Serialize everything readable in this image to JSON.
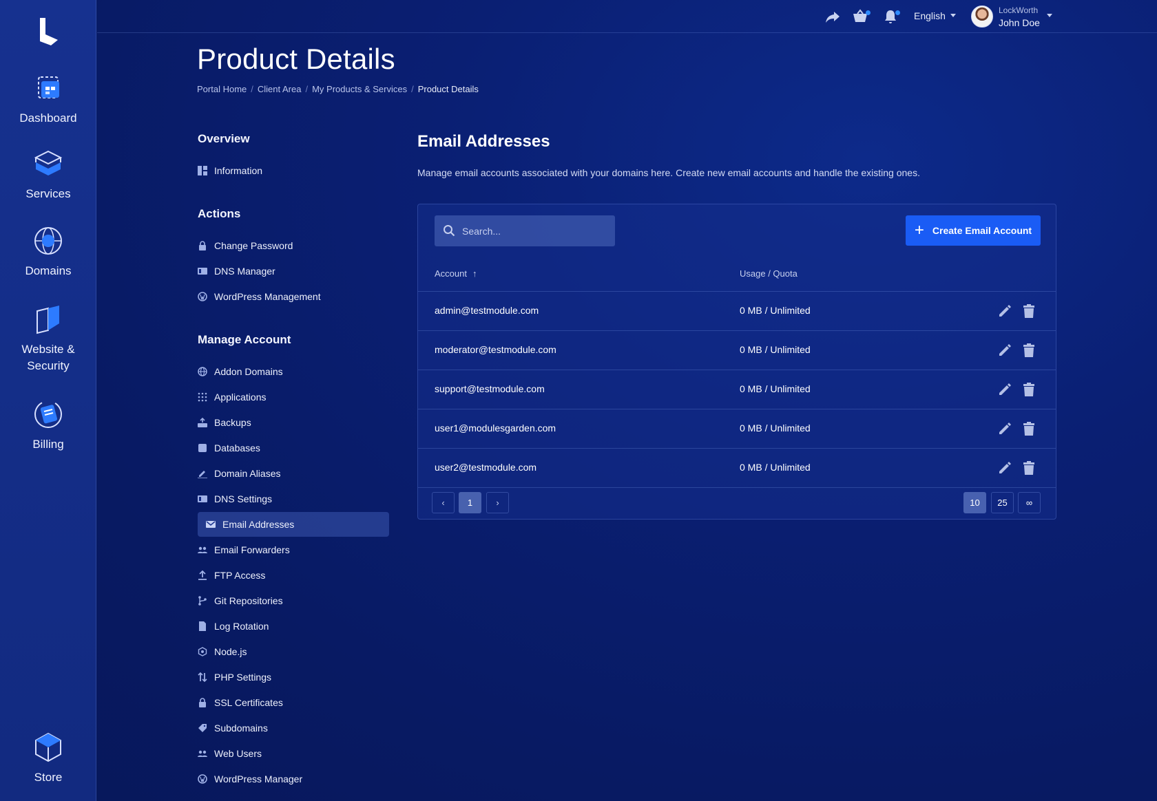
{
  "rail": {
    "items": [
      {
        "label": "Dashboard",
        "icon": "dashboard-icon"
      },
      {
        "label": "Services",
        "icon": "services-icon"
      },
      {
        "label": "Domains",
        "icon": "domains-icon"
      },
      {
        "label": "Website & Security",
        "icon": "website-security-icon"
      },
      {
        "label": "Billing",
        "icon": "billing-icon"
      },
      {
        "label": "Store",
        "icon": "store-icon"
      }
    ]
  },
  "topbar": {
    "language": "English",
    "company": "LockWorth",
    "user": "John Doe"
  },
  "header": {
    "title": "Product Details",
    "breadcrumb": [
      "Portal Home",
      "Client Area",
      "My Products & Services",
      "Product Details"
    ]
  },
  "sidenav": {
    "overview_title": "Overview",
    "overview": [
      "Information"
    ],
    "actions_title": "Actions",
    "actions": [
      "Change Password",
      "DNS Manager",
      "WordPress Management"
    ],
    "manage_title": "Manage Account",
    "manage": [
      "Addon Domains",
      "Applications",
      "Backups",
      "Databases",
      "Domain Aliases",
      "DNS Settings",
      "Email Addresses",
      "Email Forwarders",
      "FTP Access",
      "Git Repositories",
      "Log Rotation",
      "Node.js",
      "PHP Settings",
      "SSL Certificates",
      "Subdomains",
      "Web Users",
      "WordPress Manager"
    ],
    "active": "Email Addresses"
  },
  "main": {
    "title": "Email Addresses",
    "description": "Manage email accounts associated with your domains here. Create new email accounts and handle the existing ones.",
    "search_placeholder": "Search...",
    "create_label": "Create Email Account",
    "columns": [
      "Account",
      "Usage / Quota"
    ],
    "rows": [
      {
        "account": "admin@testmodule.com",
        "usage": "0 MB / Unlimited"
      },
      {
        "account": "moderator@testmodule.com",
        "usage": "0 MB / Unlimited"
      },
      {
        "account": "support@testmodule.com",
        "usage": "0 MB / Unlimited"
      },
      {
        "account": "user1@modulesgarden.com",
        "usage": "0 MB / Unlimited"
      },
      {
        "account": "user2@testmodule.com",
        "usage": "0 MB / Unlimited"
      }
    ],
    "pagination": {
      "prev": "‹",
      "current": "1",
      "next": "›",
      "page_sizes": [
        "10",
        "25",
        "∞"
      ],
      "selected_size": "10"
    }
  },
  "colors": {
    "accent": "#1a5cf5",
    "background": "#0a1f73",
    "rail": "#16318f"
  }
}
